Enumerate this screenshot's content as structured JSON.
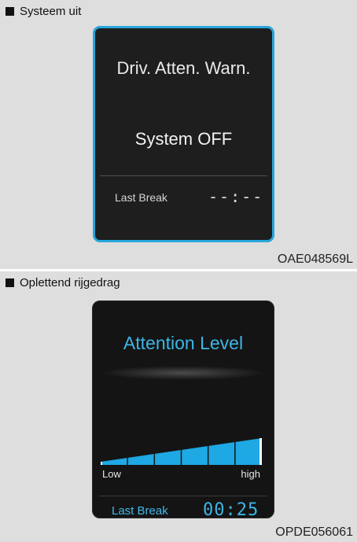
{
  "panel1": {
    "caption": "Systeem uit",
    "title": "Driv. Atten. Warn.",
    "status": "System OFF",
    "last_break_label": "Last Break",
    "last_break_value": "--:--",
    "code": "OAE048569L",
    "border_color": "#27a6da"
  },
  "panel2": {
    "caption": "Oplettend rijgedrag",
    "title": "Attention Level",
    "low_label": "Low",
    "high_label": "high",
    "last_break_label": "Last Break",
    "last_break_value": "00:25",
    "code": "OPDE056061",
    "accent_color": "#1ea8e4",
    "attention_level": 1.0,
    "segments": 6
  }
}
